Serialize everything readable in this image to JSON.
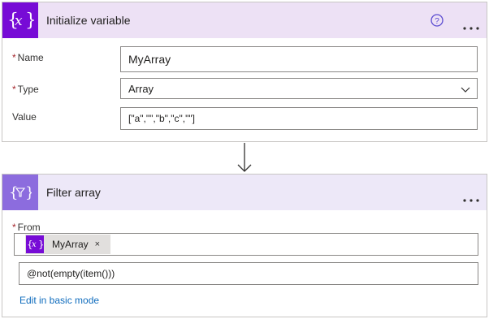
{
  "init_variable": {
    "title": "Initialize variable",
    "icon": "variable-icon",
    "name_label": "Name",
    "name_value": "MyArray",
    "type_label": "Type",
    "type_value": "Array",
    "value_label": "Value",
    "value_value": "[\"a\",\"\",\"b\",\"c\",\"\"]",
    "required_mark": "*"
  },
  "filter_array": {
    "title": "Filter array",
    "icon": "filter-variable-icon",
    "from_label": "From",
    "token_label": "MyArray",
    "token_close": "×",
    "expression": "@not(empty(item()))",
    "edit_link": "Edit in basic mode",
    "required_mark": "*"
  },
  "colors": {
    "init_header": "#ede1f5",
    "init_badge": "#770bd6",
    "filter_header": "#ede8f8",
    "filter_badge": "#8c6cde",
    "required": "#a4262c",
    "link": "#0f6cbd"
  }
}
